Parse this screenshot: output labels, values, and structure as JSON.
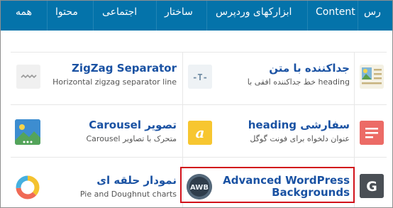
{
  "tabs": [
    {
      "label": "رس"
    },
    {
      "label": "Content"
    },
    {
      "label": "ابزارکهای وردپرس"
    },
    {
      "label": "ساختار"
    },
    {
      "label": "اجتماعی"
    },
    {
      "label": "محتوا"
    },
    {
      "label": "همه"
    }
  ],
  "widgets": [
    {
      "title": "جداکننده با متن",
      "desc": "خط جداکننده افقی با heading",
      "icon": "image-text-icon"
    },
    {
      "title": "ZigZag Separator",
      "desc": "Horizontal zigzag separator line",
      "icon": "text-divider-icon",
      "icon_glyph": "-T-"
    },
    {
      "title": "heading سفارشی",
      "desc": "عنوان دلخواه برای فونت گوگل",
      "icon": "heading-lines-icon"
    },
    {
      "title": "Carousel تصویر",
      "desc": "Carousel متحرک با تصاویر",
      "icon": "letter-a-icon",
      "icon_glyph": "a"
    },
    {
      "title": "Advanced WordPress Backgrounds",
      "title_line1": "Advanced WordPress",
      "title_line2": "Backgrounds",
      "icon": "g-logo-icon",
      "icon_glyph": "G"
    },
    {
      "title": "نمودار حلقه ای",
      "desc": "Pie and Doughnut charts",
      "icon": "doughnut-chart-icon"
    },
    {
      "title": "",
      "icon": "image-carousel-icon"
    },
    {
      "title": "",
      "icon": "awb-logo-icon",
      "icon_glyph": "AWB"
    }
  ],
  "colors": {
    "tabbar": "#0473aa",
    "title": "#1a52a3",
    "highlight": "#d1121b"
  }
}
